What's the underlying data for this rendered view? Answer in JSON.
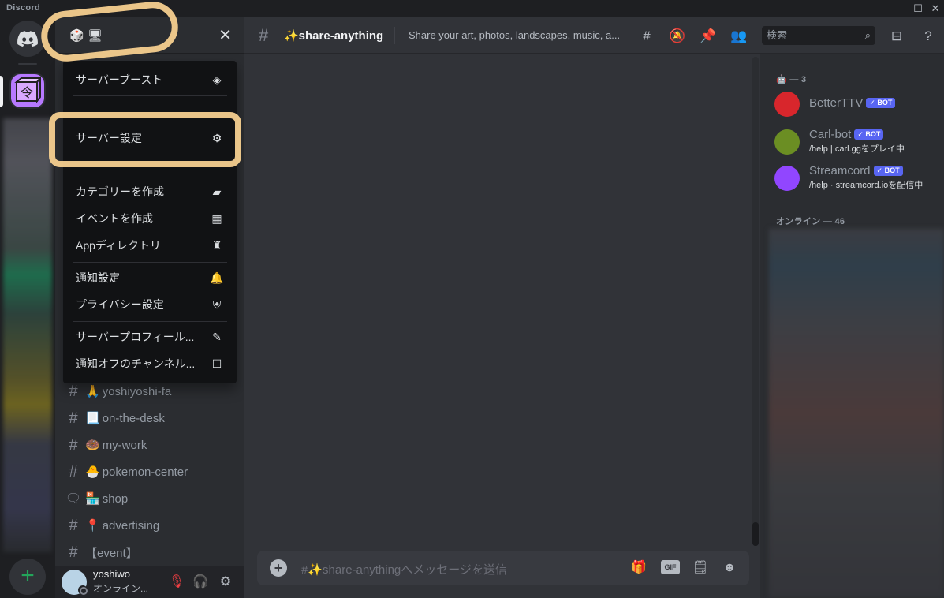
{
  "app": {
    "title": "Discord"
  },
  "window": {
    "minimize": "—",
    "maximize": "☐",
    "close": "✕"
  },
  "server": {
    "name": "🎲 🖥",
    "close_icon": "✕"
  },
  "menu": {
    "items": [
      {
        "label": "サーバーブースト",
        "icon": "boost-icon"
      },
      {
        "label": "サーバー設定",
        "icon": "gear-icon"
      },
      {
        "label": "カテゴリーを作成",
        "icon": "folder-plus-icon"
      },
      {
        "label": "イベントを作成",
        "icon": "calendar-plus-icon"
      },
      {
        "label": "Appディレクトリ",
        "icon": "robot-icon"
      },
      {
        "label": "通知設定",
        "icon": "bell-icon"
      },
      {
        "label": "プライバシー設定",
        "icon": "shield-icon"
      },
      {
        "label": "サーバープロフィール...",
        "icon": "pencil-icon"
      },
      {
        "label": "通知オフのチャンネル...",
        "icon": "checkbox-icon"
      }
    ]
  },
  "channels": [
    {
      "type": "text",
      "emoji": "🙏",
      "name": "yoshiyoshi-fa"
    },
    {
      "type": "text",
      "emoji": "📃",
      "name": "on-the-desk"
    },
    {
      "type": "text",
      "emoji": "🍩",
      "name": "my-work"
    },
    {
      "type": "text",
      "emoji": "🐣",
      "name": "pokemon-center"
    },
    {
      "type": "forum",
      "emoji": "🏪",
      "name": "shop"
    },
    {
      "type": "text",
      "emoji": "📍",
      "name": "advertising"
    },
    {
      "type": "text-special",
      "emoji": "",
      "name": "【event】"
    }
  ],
  "user": {
    "name": "yoshiwo",
    "status": "オンライン..."
  },
  "channel_header": {
    "name": "✨share-anything",
    "topic": "Share your art, photos, landscapes, music, a...",
    "search_placeholder": "検索"
  },
  "composer": {
    "placeholder": "#✨share-anythingへメッセージを送信",
    "gif_label": "GIF"
  },
  "members": {
    "bot_group": "🤖 — 3",
    "online_group": "オンライン — 46",
    "bots": [
      {
        "name": "BetterTTV",
        "badge": "✓ BOT",
        "activity": "",
        "color": "#d8262c"
      },
      {
        "name": "Carl-bot",
        "badge": "✓ BOT",
        "activity": "/help | carl.ggをプレイ中",
        "color": "#6b8e23"
      },
      {
        "name": "Streamcord",
        "badge": "✓ BOT",
        "activity": "/help · streamcord.ioを配信中",
        "color": "#9146ff"
      }
    ]
  },
  "colors": {
    "accent": "#5865f2",
    "highlight": "#f5cf8f",
    "online": "#23a55a"
  }
}
